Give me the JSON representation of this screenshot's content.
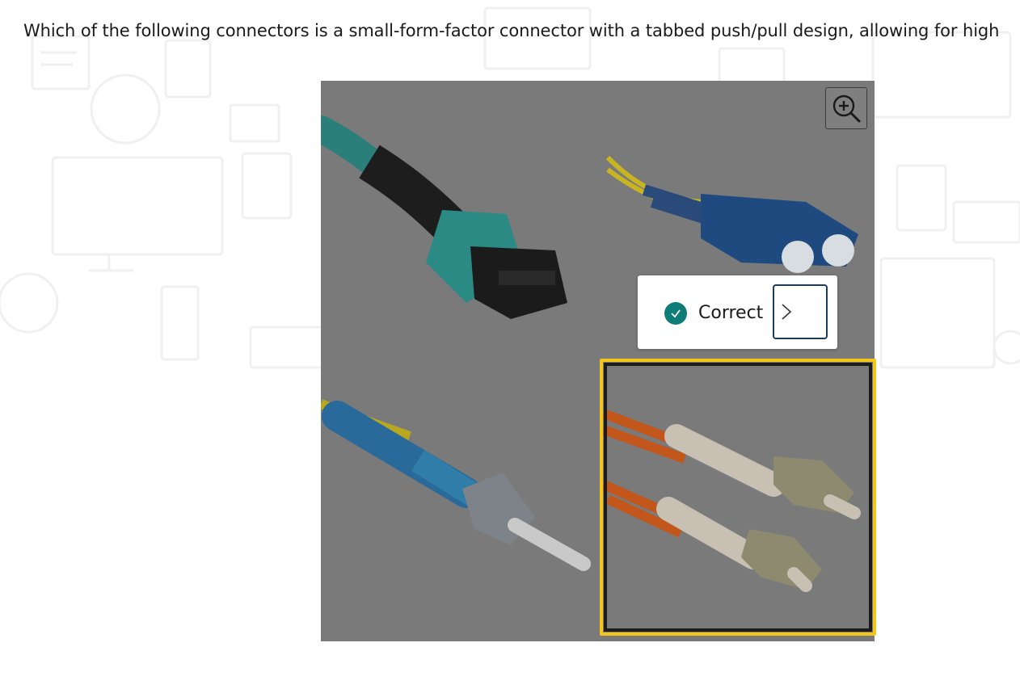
{
  "question": {
    "text": "Which of the following connectors is a small-form-factor connector with a tabbed push/pull design, allowing for high"
  },
  "image": {
    "zoom_icon": "zoom-in-icon",
    "options": [
      {
        "name": "mpo-connector",
        "selected": false
      },
      {
        "name": "sc-connector",
        "selected": false
      },
      {
        "name": "st-connector",
        "selected": false
      },
      {
        "name": "lc-connector",
        "selected": true
      }
    ]
  },
  "feedback": {
    "status_label": "Correct",
    "status_icon": "check-circle-icon",
    "next_icon": "chevron-right-icon"
  },
  "colors": {
    "selection_outline": "#f5c518",
    "correct_badge": "#0e7c77",
    "overlay_gray": "#7a7a7a"
  }
}
